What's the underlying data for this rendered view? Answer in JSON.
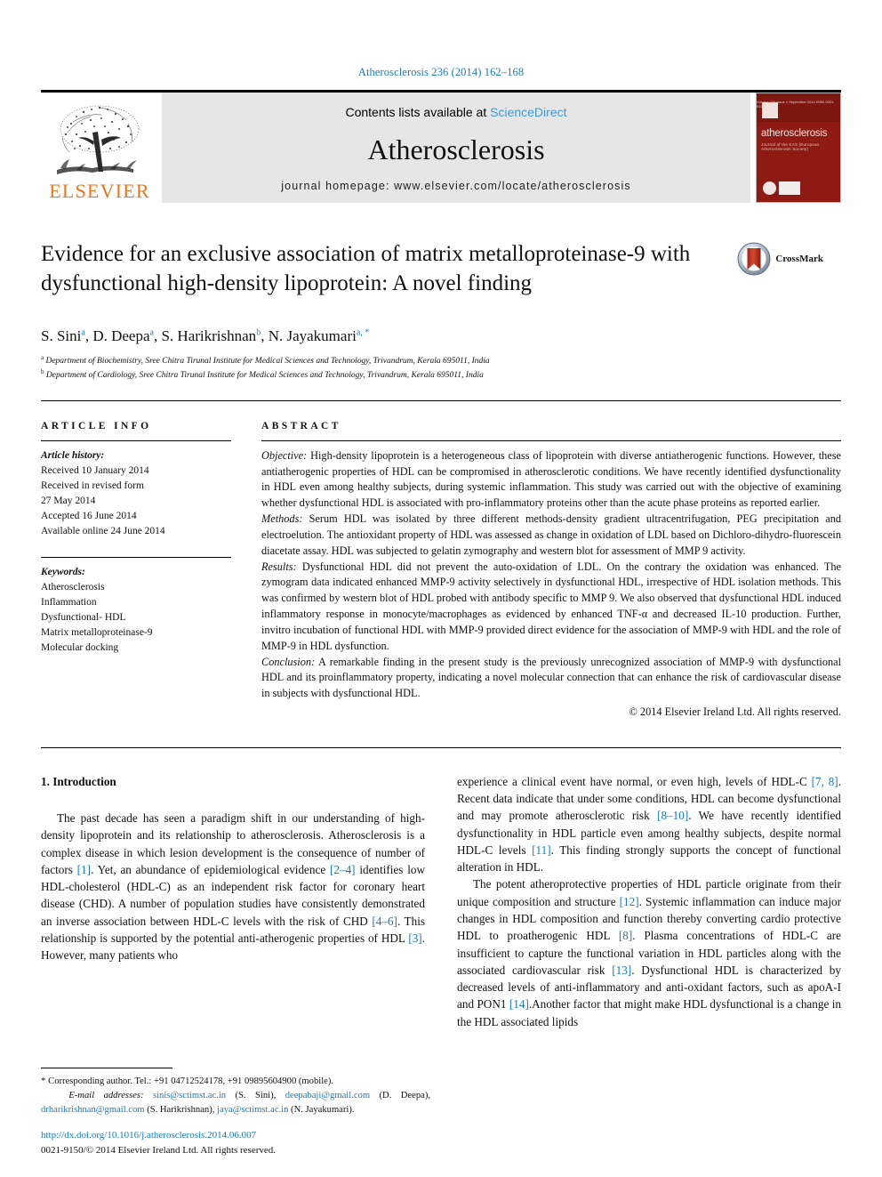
{
  "running_head": "Atherosclerosis 236 (2014) 162–168",
  "masthead": {
    "publisher_name": "ELSEVIER",
    "contents_prefix": "Contents lists available at ",
    "contents_link": "ScienceDirect",
    "journal_title": "Atherosclerosis",
    "homepage": "journal homepage: www.elsevier.com/locate/atherosclerosis",
    "cover": {
      "title": "atherosclerosis",
      "subtitle": "Journal of the EAS (European Atherosclerosis Society)",
      "topline": "Volume 236  Issue 1   September 2014   ISSN 0021-9150"
    }
  },
  "title": "Evidence for an exclusive association of matrix metalloproteinase-9 with dysfunctional high-density lipoprotein: A novel finding",
  "crossmark_label": "CrossMark",
  "authors": [
    {
      "name": "S. Sini",
      "marks": "a"
    },
    {
      "name": "D. Deepa",
      "marks": "a"
    },
    {
      "name": "S. Harikrishnan",
      "marks": "b"
    },
    {
      "name": "N. Jayakumari",
      "marks": "a, *"
    }
  ],
  "affiliations": [
    {
      "mark": "a",
      "text": "Department of Biochemistry, Sree Chitra Tirunal Institute for Medical Sciences and Technology, Trivandrum, Kerala 695011, India"
    },
    {
      "mark": "b",
      "text": "Department of Cardiology, Sree Chitra Tirunal Institute for Medical Sciences and Technology, Trivandrum, Kerala 695011, India"
    }
  ],
  "article_info": {
    "heading": "ARTICLE INFO",
    "history_label": "Article history:",
    "history": [
      "Received 10 January 2014",
      "Received in revised form",
      "27 May 2014",
      "Accepted 16 June 2014",
      "Available online 24 June 2014"
    ],
    "keywords_label": "Keywords:",
    "keywords": [
      "Atherosclerosis",
      "Inflammation",
      "Dysfunctional- HDL",
      "Matrix metalloproteinase-9",
      "Molecular docking"
    ]
  },
  "abstract": {
    "heading": "ABSTRACT",
    "sections": [
      {
        "label": "Objective:",
        "text": " High-density lipoprotein is a heterogeneous class of lipoprotein with diverse antiatherogenic functions. However, these antiatherogenic properties of HDL can be compromised in atherosclerotic conditions. We have recently identified dysfunctionality in HDL even among healthy subjects, during systemic inflammation. This study was carried out with the objective of examining whether dysfunctional HDL is associated with pro-inflammatory proteins other than the acute phase proteins as reported earlier."
      },
      {
        "label": "Methods:",
        "text": " Serum HDL was isolated by three different methods-density gradient ultracentrifugation, PEG precipitation and electroelution. The antioxidant property of HDL was assessed as change in oxidation of LDL based on Dichloro-dihydro-fluorescein diacetate assay. HDL was subjected to gelatin zymography and western blot for assessment of MMP 9 activity."
      },
      {
        "label": "Results:",
        "text": " Dysfunctional HDL did not prevent the auto-oxidation of LDL. On the contrary the oxidation was enhanced. The zymogram data indicated enhanced MMP-9 activity selectively in dysfunctional HDL, irrespective of HDL isolation methods. This was confirmed by western blot of HDL probed with antibody specific to MMP 9. We also observed that dysfunctional HDL induced inflammatory response in monocyte/macrophages as evidenced by enhanced TNF-α and decreased IL-10 production. Further, invitro incubation of functional HDL with MMP-9 provided direct evidence for the association of MMP-9 with HDL and the role of MMP-9 in HDL dysfunction."
      },
      {
        "label": "Conclusion:",
        "text": " A remarkable finding in the present study is the previously unrecognized association of MMP-9 with dysfunctional HDL and its proinflammatory property, indicating a novel molecular connection that can enhance the risk of cardiovascular disease in subjects with dysfunctional HDL."
      }
    ],
    "copyright": "© 2014 Elsevier Ireland Ltd. All rights reserved."
  },
  "body": {
    "section_heading": "1. Introduction",
    "left_paragraph_parts": [
      "The past decade has seen a paradigm shift in our understanding of high-density lipoprotein and its relationship to atherosclerosis. Atherosclerosis is a complex disease in which lesion development is the consequence of number of factors ",
      "[1]",
      ". Yet, an abundance of epidemiological evidence ",
      "[2–4]",
      " identifies low HDL-cholesterol (HDL-C) as an independent risk factor for coronary heart disease (CHD). A number of population studies have consistently demonstrated an inverse association between HDL-C levels with the risk of CHD ",
      "[4–6]",
      ". This relationship is supported by the potential anti-atherogenic properties of HDL ",
      "[3]",
      ". However, many patients who"
    ],
    "right_paragraph1_parts": [
      "experience a clinical event have normal, or even high, levels of HDL-C ",
      "[7, 8]",
      ". Recent data indicate that under some conditions, HDL can become dysfunctional and may promote atherosclerotic risk ",
      "[8–10]",
      ". We have recently identified dysfunctionality in HDL particle even among healthy subjects, despite normal HDL-C levels ",
      "[11]",
      ". This finding strongly supports the concept of functional alteration in HDL."
    ],
    "right_paragraph2_parts": [
      "The potent atheroprotective properties of HDL particle originate from their unique composition and structure ",
      "[12]",
      ". Systemic inflammation can induce major changes in HDL composition and function thereby converting cardio protective HDL to proatherogenic HDL ",
      "[8]",
      ". Plasma concentrations of HDL-C are insufficient to capture the functional variation in HDL particles along with the associated cardiovascular risk ",
      "[13]",
      ". Dysfunctional HDL is characterized by decreased levels of anti-inflammatory and anti-oxidant factors, such as apoA-I and PON1 ",
      "[14]",
      ".Another factor that might make HDL dysfunctional is a change in the HDL associated lipids"
    ]
  },
  "footnote": {
    "corresponding": "Corresponding author. Tel.: +91 04712524178, +91 09895604900 (mobile).",
    "email_label": "E-mail addresses:",
    "emails": [
      {
        "address": "sinis@sctimst.ac.in",
        "owner": " (S. Sini), "
      },
      {
        "address": "deepabaji@gmail.com",
        "owner": " (D. Deepa), "
      },
      {
        "address": "drharikrishnan@gmail.com",
        "owner": " (S. Harikrishnan), "
      },
      {
        "address": "jaya@sctimst.ac.in",
        "owner": " (N. Jayakumari)."
      }
    ],
    "doi": "http://dx.doi.org/10.1016/j.atherosclerosis.2014.06.007",
    "issn": "0021-9150/© 2014 Elsevier Ireland Ltd. All rights reserved."
  },
  "colors": {
    "link_blue": "#1a7bb5",
    "sciencedirect_blue": "#3d9bd6",
    "elsevier_orange": "#E8761C",
    "cover_red": "#8d1b13"
  }
}
